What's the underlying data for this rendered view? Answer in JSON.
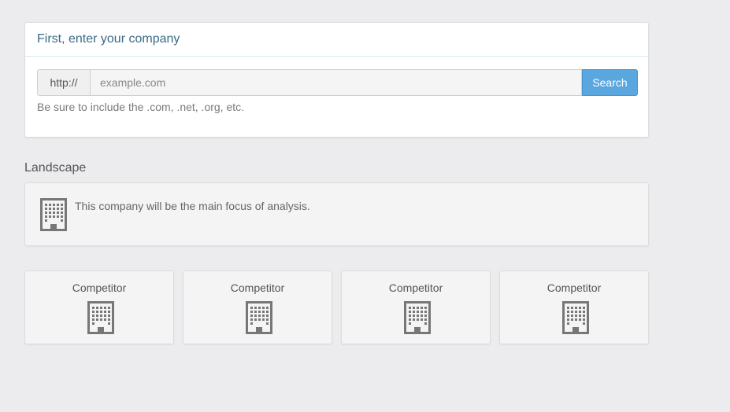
{
  "company_panel": {
    "heading": "First, enter your company",
    "url_prefix": "http://",
    "url_placeholder": "example.com",
    "url_value": "",
    "search_label": "Search",
    "help_text": "Be sure to include the .com, .net, .org, etc."
  },
  "landscape": {
    "title": "Landscape",
    "main_card": {
      "icon": "building-icon",
      "text": "This company will be the main focus of analysis."
    },
    "competitors": [
      {
        "label": "Competitor",
        "icon": "building-icon"
      },
      {
        "label": "Competitor",
        "icon": "building-icon"
      },
      {
        "label": "Competitor",
        "icon": "building-icon"
      },
      {
        "label": "Competitor",
        "icon": "building-icon"
      }
    ]
  },
  "colors": {
    "background": "#ececee",
    "heading_text": "#3a6a86",
    "search_button": "#5aa7e0",
    "icon": "#777777"
  }
}
